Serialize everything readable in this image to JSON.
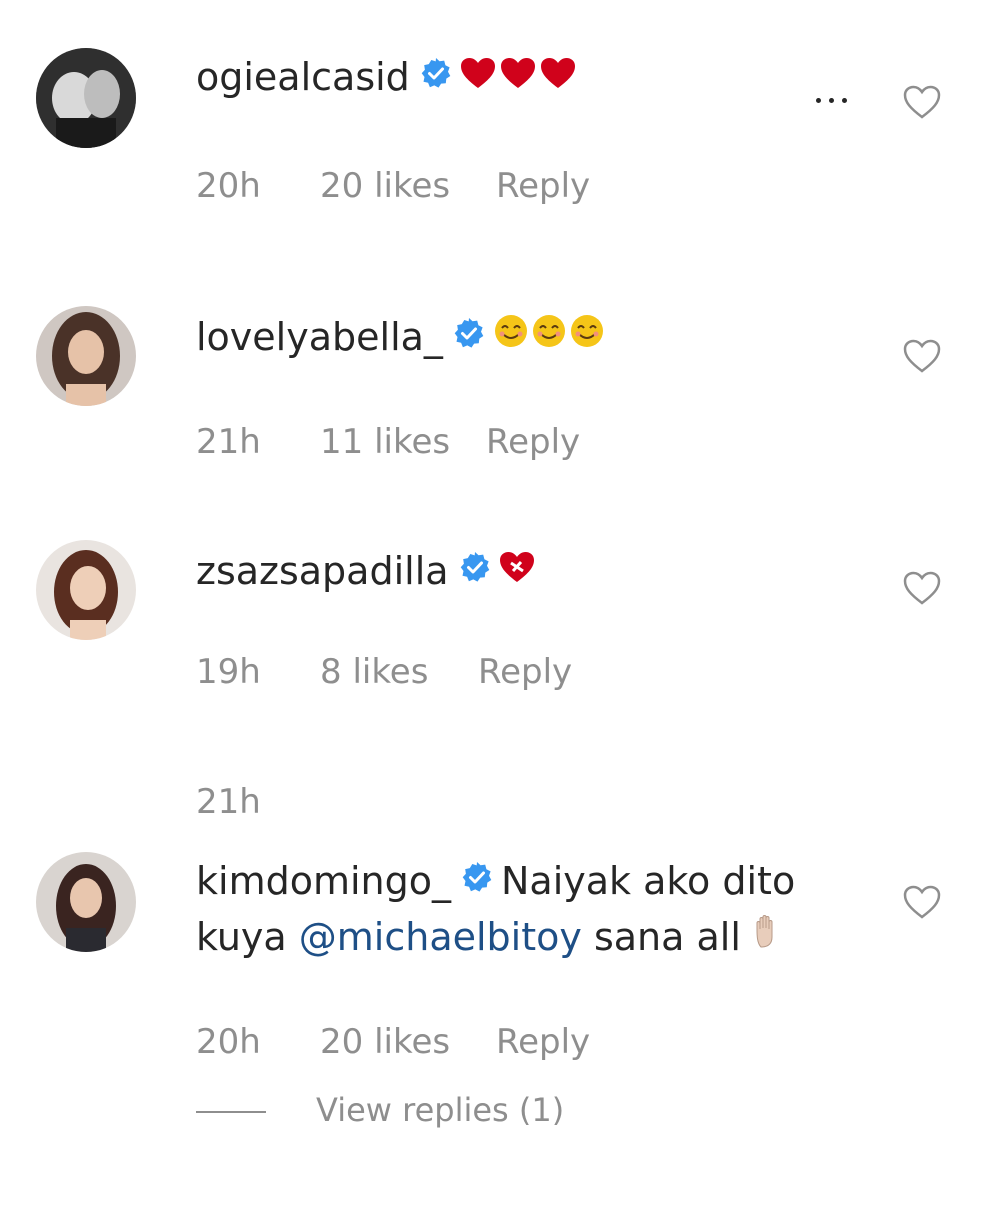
{
  "comments": [
    {
      "username": "ogiealcasid",
      "text": "",
      "emojis": [
        "red-heart",
        "red-heart",
        "red-heart"
      ],
      "time": "20h",
      "likes": "20 likes",
      "reply": "Reply"
    },
    {
      "username": "lovelyabella_",
      "text": "",
      "emojis": [
        "smiling-face",
        "smiling-face",
        "smiling-face"
      ],
      "time": "21h",
      "likes": "11 likes",
      "reply": "Reply"
    },
    {
      "username": "zsazsapadilla",
      "text": "",
      "emojis": [
        "mending-heart"
      ],
      "time": "19h",
      "likes": "8 likes",
      "reply": "Reply"
    },
    {
      "header_time": "21h",
      "username": "kimdomingo_",
      "text_start": "Naiyak ako dito",
      "text_line2_prefix": "kuya ",
      "mention": "@michaelbitoy",
      "text_end": " sana all",
      "emojis": [
        "raised-hand"
      ],
      "time": "20h",
      "likes": "20 likes",
      "reply": "Reply",
      "view_replies": "View replies (1)"
    }
  ],
  "icons": {
    "verified": "verified-badge-icon",
    "like": "heart-outline-icon",
    "more": "more-options-icon"
  },
  "colors": {
    "verified_blue": "#3897f0",
    "meta_gray": "#8e8e8e",
    "mention_blue": "#1e4f86"
  }
}
